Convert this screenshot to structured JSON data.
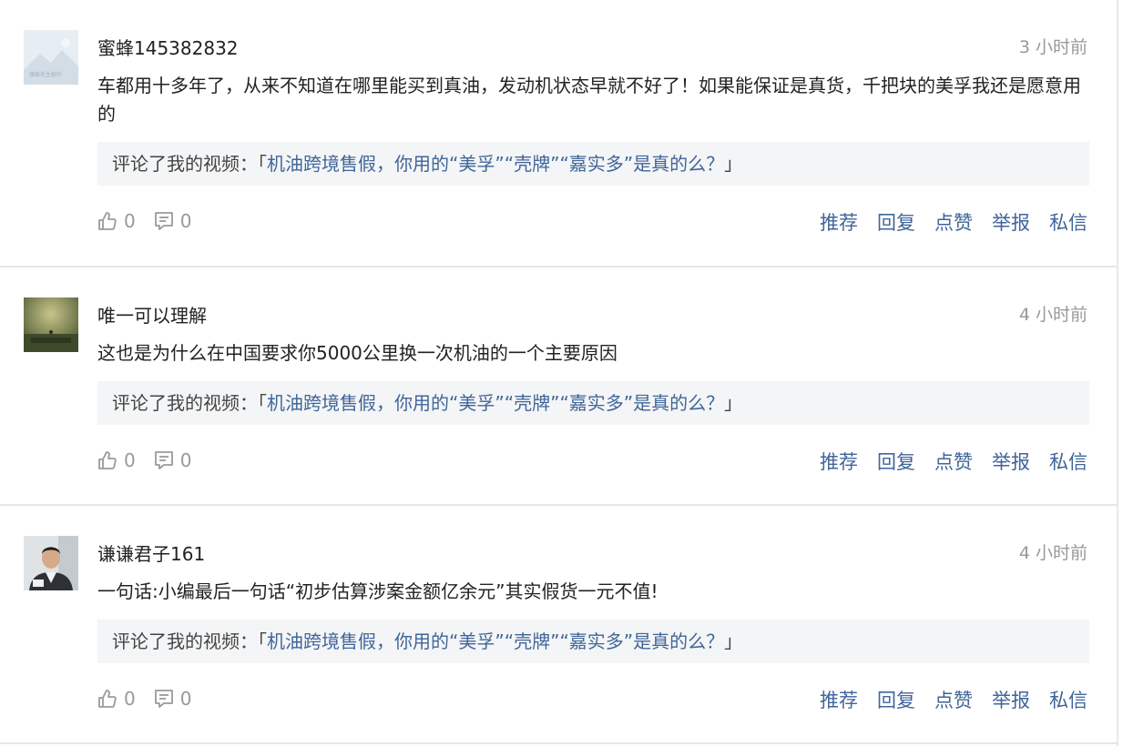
{
  "comments": [
    {
      "username": "蜜蜂145382832",
      "time": "3 小时前",
      "content": "车都用十多年了，从来不知道在哪里能买到真油，发动机状态早就不好了！如果能保证是真货，千把块的美孚我还是愿意用的",
      "quote_prefix": "评论了我的视频：",
      "bracket_open": "「",
      "video_title": "机油跨境售假，你用的“美孚”“壳牌”“嘉实多”是真的么？",
      "bracket_close": "」",
      "likes": "0",
      "replies": "0",
      "avatar_caption": "頭條先生創作"
    },
    {
      "username": "唯一可以理解",
      "time": "4 小时前",
      "content": "这也是为什么在中国要求你5000公里换一次机油的一个主要原因",
      "quote_prefix": "评论了我的视频：",
      "bracket_open": "「",
      "video_title": "机油跨境售假，你用的“美孚”“壳牌”“嘉实多”是真的么？",
      "bracket_close": "」",
      "likes": "0",
      "replies": "0"
    },
    {
      "username": "谦谦君子161",
      "time": "4 小时前",
      "content": "一句话:小编最后一句话“初步估算涉案金额亿余元”其实假货一元不值!",
      "quote_prefix": "评论了我的视频：",
      "bracket_open": "「",
      "video_title": "机油跨境售假，你用的“美孚”“壳牌”“嘉实多”是真的么？",
      "bracket_close": "」",
      "likes": "0",
      "replies": "0"
    }
  ],
  "actions": {
    "recommend": "推荐",
    "reply": "回复",
    "like": "点赞",
    "report": "举报",
    "message": "私信"
  },
  "colors": {
    "link_blue": "#406599",
    "meta_gray": "#999999",
    "quote_bg": "#f4f5f6"
  }
}
